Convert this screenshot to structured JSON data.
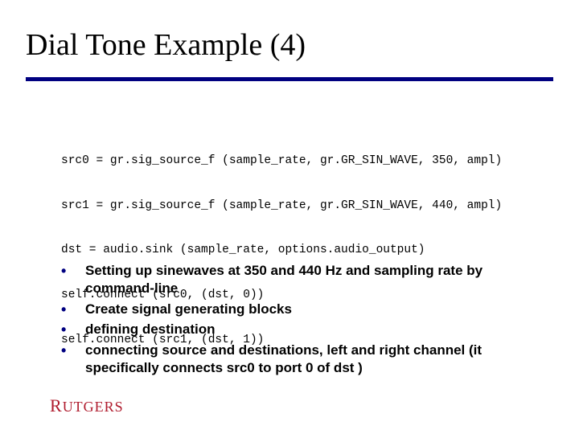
{
  "title": "Dial Tone Example (4)",
  "code": {
    "lines": [
      "src0 = gr.sig_source_f (sample_rate, gr.GR_SIN_WAVE, 350, ampl)",
      "src1 = gr.sig_source_f (sample_rate, gr.GR_SIN_WAVE, 440, ampl)",
      "dst = audio.sink (sample_rate, options.audio_output)",
      "self.connect (src0, (dst, 0))",
      "self.connect (src1, (dst, 1))"
    ]
  },
  "bullets": [
    "Setting up sinewaves at 350 and 440 Hz and sampling rate by command-line",
    "Create signal generating blocks",
    "defining destination",
    "connecting source and destinations, left and right channel (it specifically connects src0 to port 0 of dst )"
  ],
  "logo_text": "Rutgers",
  "accent_color": "#000080",
  "logo_color": "#b01c2e"
}
